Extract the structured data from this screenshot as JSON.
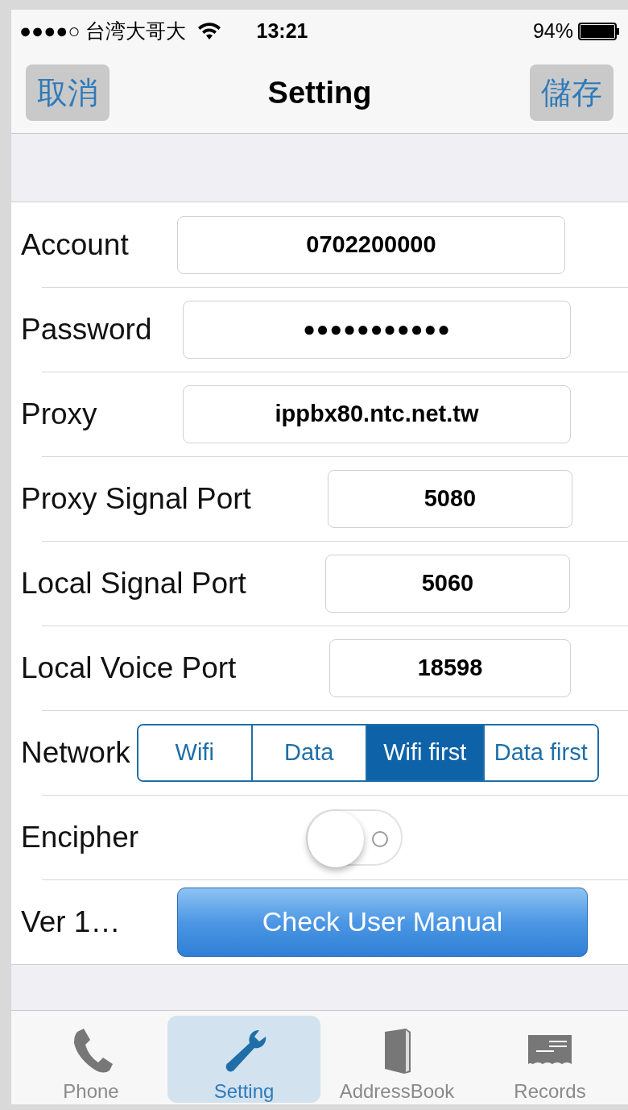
{
  "status_bar": {
    "signal": "●●●●○",
    "carrier": "台湾大哥大",
    "time": "13:21",
    "battery": "94%"
  },
  "nav_bar": {
    "left_button": "取消",
    "title": "Setting",
    "right_button": "儲存"
  },
  "fields": [
    {
      "label": "Account",
      "value": "0702200000"
    },
    {
      "label": "Password",
      "value": "●●●●●●●●●●●"
    },
    {
      "label": "Proxy",
      "value": "ippbx80.ntc.net.tw"
    },
    {
      "label": "Proxy Signal Port",
      "value": "5080"
    },
    {
      "label": "Local Signal Port",
      "value": "5060"
    },
    {
      "label": "Local Voice Port",
      "value": "18598"
    }
  ],
  "network": {
    "label": "Network",
    "options": [
      {
        "label": "Wifi",
        "selected": false
      },
      {
        "label": "Data",
        "selected": false
      },
      {
        "label": "Wifi first",
        "selected": true
      },
      {
        "label": "Data first",
        "selected": false
      }
    ]
  },
  "encipher": {
    "label": "Encipher",
    "on": false
  },
  "version": {
    "label": "Ver  1…",
    "button": "Check User Manual"
  },
  "tab_bar": [
    {
      "label": "Phone",
      "kind": "phone",
      "selected": false
    },
    {
      "label": "Setting",
      "kind": "settings",
      "selected": true
    },
    {
      "label": "AddressBook",
      "kind": "contacts",
      "selected": false
    },
    {
      "label": "Records",
      "kind": "records",
      "selected": false
    }
  ]
}
